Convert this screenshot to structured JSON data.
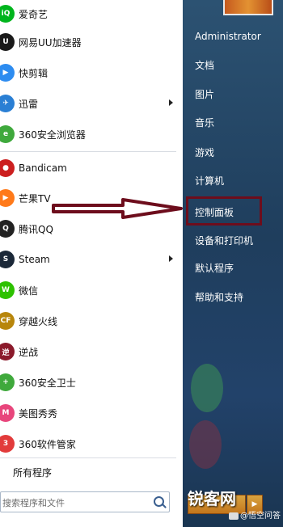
{
  "programs": [
    {
      "label": "爱奇艺",
      "icon": "iqiyi-icon",
      "color": "#00b51d",
      "glyph": "iQ",
      "submenu": false
    },
    {
      "label": "网易UU加速器",
      "icon": "uu-accelerator-icon",
      "color": "#1a1a1a",
      "glyph": "U",
      "submenu": false
    },
    {
      "label": "快剪辑",
      "icon": "kuaijianji-icon",
      "color": "#2d8cf0",
      "glyph": "▶",
      "submenu": false
    },
    {
      "label": "迅雷",
      "icon": "xunlei-icon",
      "color": "#2a7fd4",
      "glyph": "✈",
      "submenu": true
    },
    {
      "label": "360安全浏览器",
      "icon": "360-browser-icon",
      "color": "#3fa93c",
      "glyph": "e",
      "submenu": false
    },
    {
      "label": "Bandicam",
      "icon": "bandicam-icon",
      "color": "#cc1f1f",
      "glyph": "●",
      "submenu": false
    },
    {
      "label": "芒果TV",
      "icon": "mangotv-icon",
      "color": "#ff7a1a",
      "glyph": "▶",
      "submenu": false
    },
    {
      "label": "腾讯QQ",
      "icon": "qq-icon",
      "color": "#222222",
      "glyph": "Q",
      "submenu": false
    },
    {
      "label": "Steam",
      "icon": "steam-icon",
      "color": "#1b2838",
      "glyph": "S",
      "submenu": true
    },
    {
      "label": "微信",
      "icon": "wechat-icon",
      "color": "#2dc100",
      "glyph": "W",
      "submenu": false
    },
    {
      "label": "穿越火线",
      "icon": "crossfire-icon",
      "color": "#b8860b",
      "glyph": "CF",
      "submenu": false
    },
    {
      "label": "逆战",
      "icon": "nizhan-icon",
      "color": "#8b1a2b",
      "glyph": "逆",
      "submenu": false
    },
    {
      "label": "360安全卫士",
      "icon": "360-security-icon",
      "color": "#3fa93c",
      "glyph": "+",
      "submenu": false
    },
    {
      "label": "美图秀秀",
      "icon": "meitu-icon",
      "color": "#e8467c",
      "glyph": "M",
      "submenu": false
    },
    {
      "label": "360软件管家",
      "icon": "360-software-icon",
      "color": "#e23b3b",
      "glyph": "3",
      "submenu": false
    }
  ],
  "all_programs": "所有程序",
  "search_placeholder": "搜索程序和文件",
  "right_items": [
    {
      "label": "Administrator",
      "name": "right-item-administrator"
    },
    {
      "label": "文档",
      "name": "right-item-documents"
    },
    {
      "label": "图片",
      "name": "right-item-pictures"
    },
    {
      "label": "音乐",
      "name": "right-item-music"
    },
    {
      "label": "游戏",
      "name": "right-item-games"
    },
    {
      "label": "计算机",
      "name": "right-item-computer"
    },
    {
      "label": "控制面板",
      "name": "right-item-control-panel"
    },
    {
      "label": "设备和打印机",
      "name": "right-item-devices-printers"
    },
    {
      "label": "默认程序",
      "name": "right-item-default-programs"
    },
    {
      "label": "帮助和支持",
      "name": "right-item-help-support"
    }
  ],
  "watermark": {
    "title": "锐客网",
    "subtitle": "@悟空问答"
  },
  "colors": {
    "highlight": "#6d0d1c",
    "right_panel": "#1f3e5d"
  }
}
